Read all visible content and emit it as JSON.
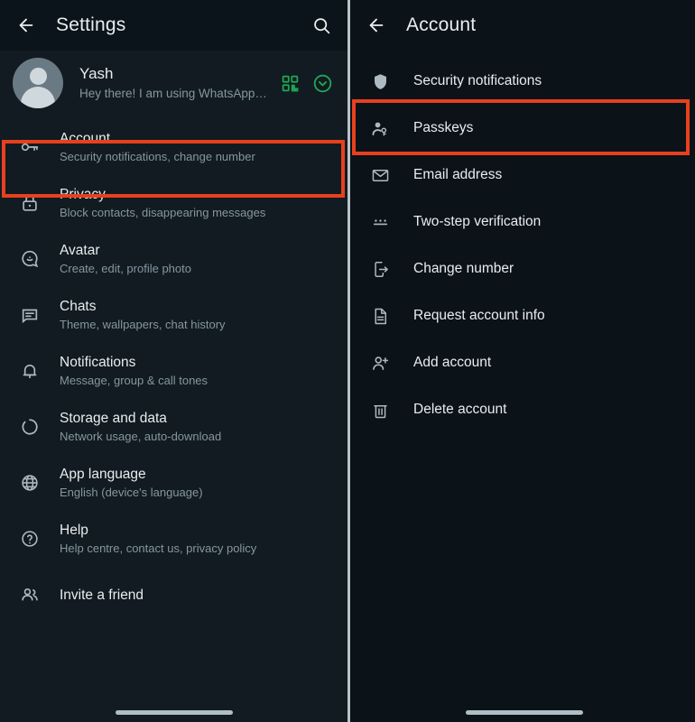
{
  "left_panel": {
    "appbar": {
      "back_icon": "arrow-left-icon",
      "title": "Settings",
      "search_icon": "search-icon"
    },
    "profile": {
      "name": "Yash",
      "status": "Hey there! I am using WhatsApp…",
      "avatar_icon": "person-avatar",
      "qr_icon": "qr-code-icon",
      "chevron_icon": "chevron-down-circle-icon"
    },
    "items": [
      {
        "icon": "key-icon",
        "title": "Account",
        "subtitle": "Security notifications, change number"
      },
      {
        "icon": "lock-icon",
        "title": "Privacy",
        "subtitle": "Block contacts, disappearing messages"
      },
      {
        "icon": "avatar-face-icon",
        "title": "Avatar",
        "subtitle": "Create, edit, profile photo"
      },
      {
        "icon": "chat-bubble-icon",
        "title": "Chats",
        "subtitle": "Theme, wallpapers, chat history"
      },
      {
        "icon": "bell-icon",
        "title": "Notifications",
        "subtitle": "Message, group & call tones"
      },
      {
        "icon": "storage-ring-icon",
        "title": "Storage and data",
        "subtitle": "Network usage, auto-download"
      },
      {
        "icon": "globe-icon",
        "title": "App language",
        "subtitle": "English (device's language)"
      },
      {
        "icon": "help-circle-icon",
        "title": "Help",
        "subtitle": "Help centre, contact us, privacy policy"
      },
      {
        "icon": "people-icon",
        "title": "Invite a friend",
        "subtitle": ""
      }
    ]
  },
  "right_panel": {
    "appbar": {
      "back_icon": "arrow-left-icon",
      "title": "Account"
    },
    "items": [
      {
        "icon": "shield-icon",
        "label": "Security notifications"
      },
      {
        "icon": "person-key-icon",
        "label": "Passkeys"
      },
      {
        "icon": "envelope-icon",
        "label": "Email address"
      },
      {
        "icon": "three-dots-icon",
        "label": "Two-step verification"
      },
      {
        "icon": "phone-arrow-icon",
        "label": "Change number"
      },
      {
        "icon": "document-icon",
        "label": "Request account info"
      },
      {
        "icon": "person-plus-icon",
        "label": "Add account"
      },
      {
        "icon": "trash-icon",
        "label": "Delete account"
      }
    ]
  },
  "highlights": [
    {
      "name": "account-highlight",
      "color": "#e8401e"
    },
    {
      "name": "passkeys-highlight",
      "color": "#e8401e"
    }
  ],
  "theme": {
    "background": "#111b21",
    "panel_right_background": "#0b1218",
    "appbar_background": "#0b141a",
    "primary_text": "#e9edef",
    "secondary_text": "#8696a0",
    "icon_color": "#aebac1",
    "accent_green": "#1fa855",
    "highlight_red": "#e8401e",
    "divider": "#b9c2c7"
  }
}
